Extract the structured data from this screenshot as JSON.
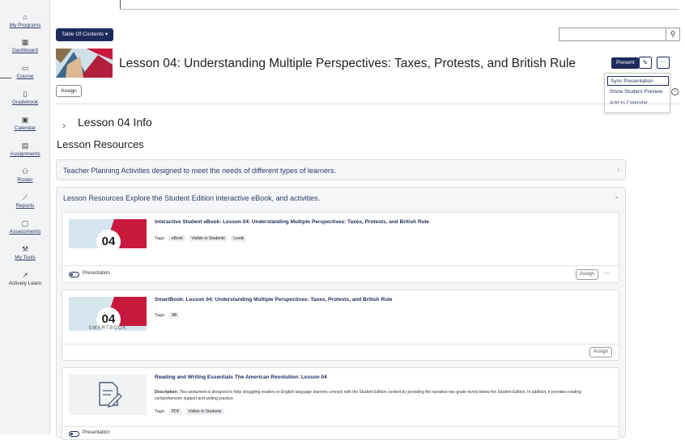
{
  "sidebar": {
    "items": [
      {
        "label": "My Programs",
        "icon": "home-icon"
      },
      {
        "label": "Dashboard",
        "icon": "dashboard-icon"
      },
      {
        "label": "Course",
        "icon": "course-icon"
      },
      {
        "label": "Gradebook",
        "icon": "gradebook-icon"
      },
      {
        "label": "Calendar",
        "icon": "calendar-icon"
      },
      {
        "label": "Assignments",
        "icon": "assignments-icon"
      },
      {
        "label": "Roster",
        "icon": "roster-icon"
      },
      {
        "label": "Reports",
        "icon": "reports-icon"
      },
      {
        "label": "Assessments",
        "icon": "assessments-icon"
      },
      {
        "label": "My Tools",
        "icon": "tools-icon"
      },
      {
        "label": "Actively Learn",
        "icon": "external-link-icon"
      }
    ]
  },
  "header": {
    "toc_label": "Table Of Contents",
    "search_placeholder": "",
    "lesson_title": "Lesson 04: Understanding Multiple Perspectives: Taxes, Protests, and British Rule",
    "present_label": "Present",
    "assign_label": "Assign",
    "menu": [
      "Sync Presentation",
      "Show Student Preview",
      "Add to Calendar"
    ]
  },
  "main": {
    "info_title": "Lesson 04 Info",
    "resources_title": "Lesson Resources",
    "panels": [
      {
        "title": "Teacher Planning Activities designed to meet the needs of different types of learners."
      },
      {
        "title": "Lesson Resources Explore the Student Edition interactive eBook, and activities."
      }
    ],
    "cards": [
      {
        "title": "Interactive Student eBook: Lesson 04: Understanding Multiple Perspectives: Taxes, Protests, and British Rule",
        "thumb_num": "04",
        "tags_label": "Tags:",
        "tags": [
          "eBook",
          "Visible to Students",
          "Lexile"
        ],
        "toggle_label": "Presentation",
        "assign_label": "Assign"
      },
      {
        "title": "SmartBook: Lesson 04: Understanding Multiple Perspectives: Taxes, Protests, and British Rule",
        "thumb_num": "04",
        "thumb_sub": "SMARTBOOK",
        "tags_label": "Tags:",
        "tags": [
          "SB"
        ],
        "assign_label": "Assign"
      },
      {
        "title": "Reading and Writing Essentials The American Revolution: Lesson 04",
        "desc_label": "Description:",
        "desc": "This worksheet is designed to help struggling readers or English language learners connect with the Student Edition content by providing the narrative two grade levels below the Student Edition. In addition, it provides reading comprehension support and writing practice.",
        "tags_label": "Tags:",
        "tags": [
          "PDF",
          "Visible to Students"
        ],
        "toggle_label": "Presentation"
      }
    ]
  },
  "colors": {
    "brand": "#1f2a5c",
    "accent": "#c8193c",
    "panel_bg": "#f5f6f8"
  }
}
